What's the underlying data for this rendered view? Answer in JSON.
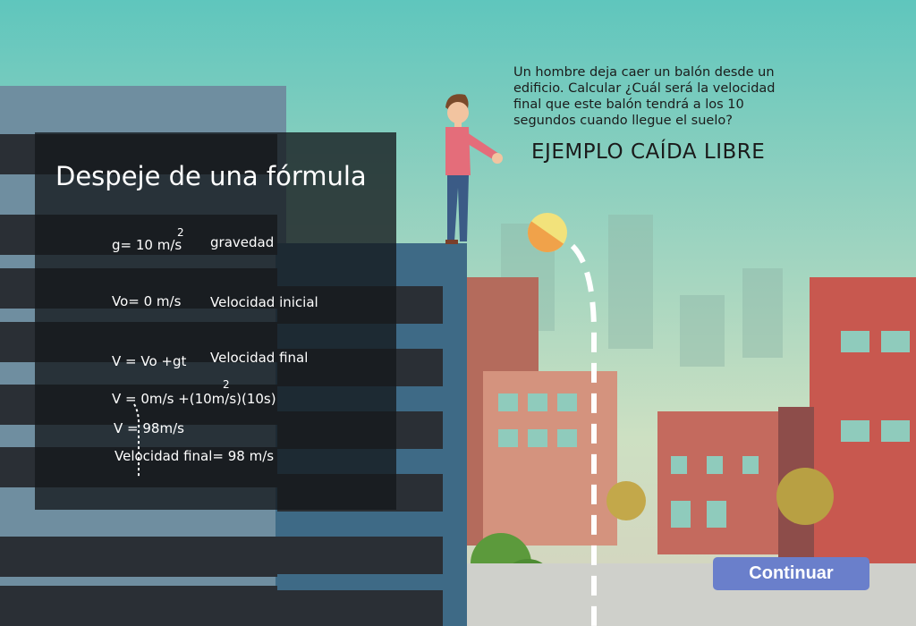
{
  "formula": {
    "title": "Despeje de una fórmula",
    "rows": [
      {
        "formula": "g= 10 m/s",
        "sup": "2",
        "desc": "gravedad"
      },
      {
        "formula": "Vo= 0 m/s",
        "desc": "Velocidad inicial"
      },
      {
        "formula": "V = Vo +gt",
        "desc": "Velocidad final"
      }
    ],
    "step1": "V = 0m/s +(10m/s)(10s)",
    "step1_sup": "2",
    "step2": "V = 98m/s",
    "result": "Velocidad final= 98 m/s"
  },
  "problem": {
    "question": "Un hombre deja caer un balón desde un edificio. Calcular ¿Cuál será la velocidad final que este balón tendrá a los 10 segundos cuando llegue el suelo?",
    "heading": "EJEMPLO CAÍDA LIBRE"
  },
  "continue_button": "Continuar"
}
